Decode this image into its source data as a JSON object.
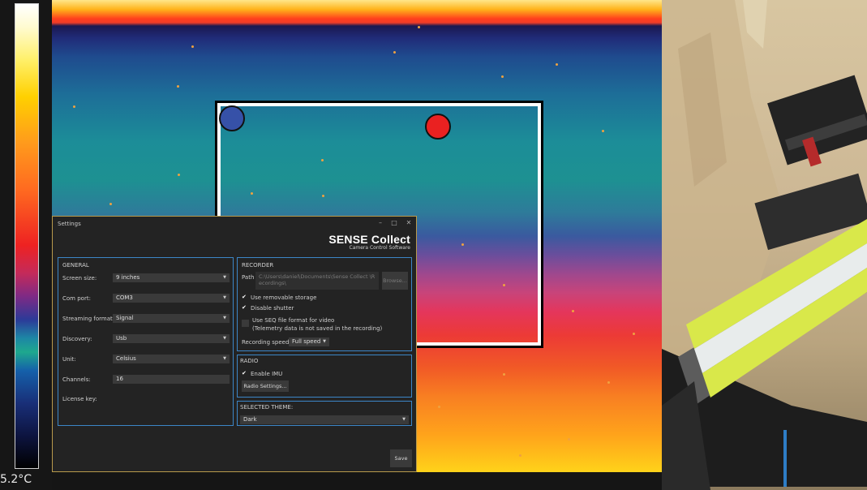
{
  "palette": {
    "temperature_label": "5.2°C"
  },
  "settings": {
    "title": "Settings",
    "window_buttons": {
      "minimize": "–",
      "maximize": "□",
      "close": "✕"
    },
    "brand": {
      "name": "SENSE Collect",
      "subtitle": "Camera Control Software"
    },
    "general": {
      "header": "GENERAL",
      "screen_size": {
        "label": "Screen size:",
        "value": "9 inches"
      },
      "com_port": {
        "label": "Com port:",
        "value": "COM3"
      },
      "streaming_format": {
        "label": "Streaming format:",
        "value": "Signal"
      },
      "discovery": {
        "label": "Discovery:",
        "value": "Usb"
      },
      "unit": {
        "label": "Unit:",
        "value": "Celsius"
      },
      "channels": {
        "label": "Channels:",
        "value": "16"
      },
      "license_key": {
        "label": "License key:",
        "value": ""
      }
    },
    "recorder": {
      "header": "RECORDER",
      "path_label": "Path",
      "path_value": "C:\\Users\\daniel\\Documents\\Sense Collect \\Recordings\\",
      "browse_label": "Browse...",
      "use_removable_storage": {
        "label": "Use removable storage",
        "checked": true
      },
      "disable_shutter": {
        "label": "Disable shutter",
        "checked": true
      },
      "seq_format": {
        "label": "Use SEQ file format for video",
        "note": "(Telemetry data is not saved in the recording)",
        "checked": false
      },
      "recording_speed": {
        "label": "Recording speed",
        "value": "Full speed"
      }
    },
    "radio": {
      "header": "RADIO",
      "enable_imu": {
        "label": "Enable IMU",
        "checked": true
      },
      "radio_settings_label": "Radio Settings..."
    },
    "theme": {
      "header": "SELECTED THEME:",
      "value": "Dark"
    },
    "save_label": "Save"
  },
  "colors": {
    "accent_border": "#3c86c7",
    "dialog_bg": "#232323",
    "dialog_frame": "#b89a4c"
  }
}
